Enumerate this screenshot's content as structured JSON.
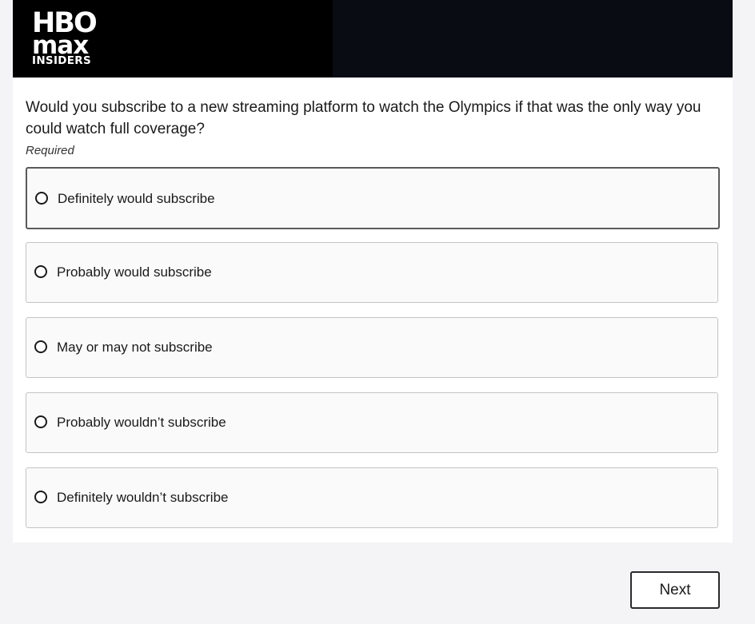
{
  "brand": {
    "logo_line1": "HBO",
    "logo_line2": "max",
    "logo_line3": "INSIDERS",
    "banner_color": "#0a0c14",
    "logo_bg_color": "#000000"
  },
  "survey": {
    "question": "Would you subscribe to a new streaming platform to watch the Olympics if that was the only way you could watch full coverage?",
    "required_label": "Required",
    "options": [
      {
        "label": "Definitely would subscribe",
        "selected": false,
        "focused": true
      },
      {
        "label": "Probably would subscribe",
        "selected": false,
        "focused": false
      },
      {
        "label": "May or may not subscribe",
        "selected": false,
        "focused": false
      },
      {
        "label": "Probably wouldn’t subscribe",
        "selected": false,
        "focused": false
      },
      {
        "label": "Definitely wouldn’t subscribe",
        "selected": false,
        "focused": false
      }
    ]
  },
  "navigation": {
    "next_label": "Next"
  }
}
